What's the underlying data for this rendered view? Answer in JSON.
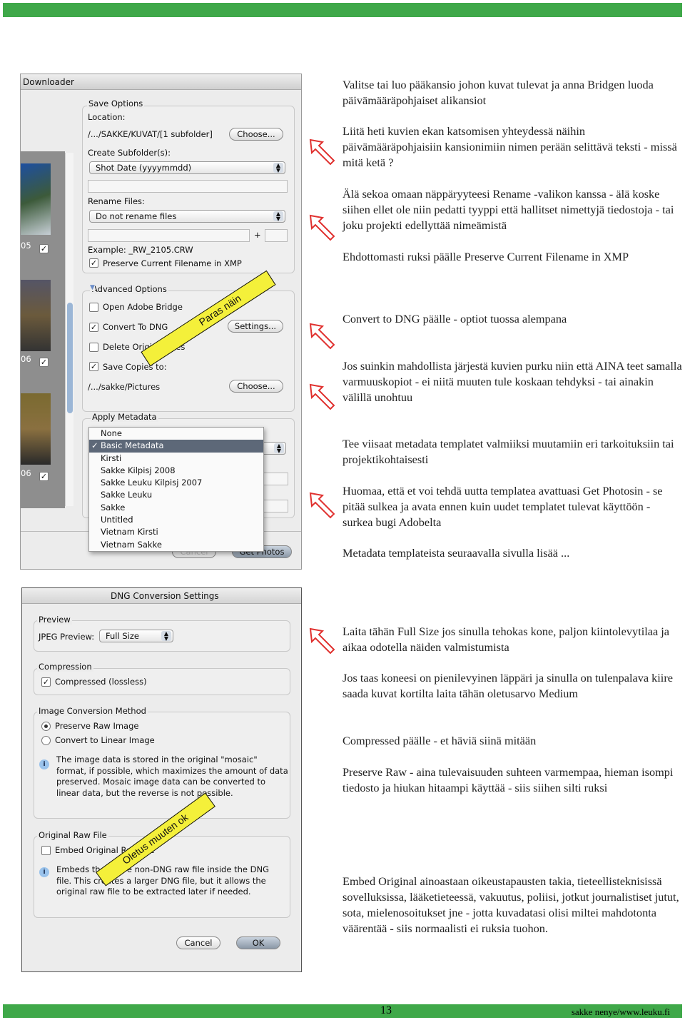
{
  "colors": {
    "green_bar": "#3fa849",
    "arrow": "#e0312f",
    "tape": "#f4f03a"
  },
  "downloader": {
    "title": "Downloader",
    "thumb_labels": [
      "05",
      "06",
      "06"
    ],
    "save_options": {
      "legend": "Save Options",
      "location_label": "Location:",
      "location_value": "/.../SAKKE/KUVAT/[1 subfolder]",
      "choose": "Choose...",
      "subfolder_label": "Create Subfolder(s):",
      "subfolder_value": "Shot Date (yyyymmdd)",
      "rename_label": "Rename Files:",
      "rename_value": "Do not rename files",
      "plus": "+",
      "example": "Example:  _RW_2105.CRW",
      "preserve": "Preserve Current Filename in XMP"
    },
    "advanced": {
      "legend": "Advanced Options",
      "open_bridge": "Open Adobe Bridge",
      "convert_dng": "Convert To DNG",
      "settings": "Settings...",
      "delete_originals": "Delete Original Files",
      "save_copies": "Save Copies to:",
      "copies_path": "/.../sakke/Pictures",
      "choose": "Choose..."
    },
    "metadata": {
      "legend": "Apply Metadata",
      "options": [
        "None",
        "Basic Metadata",
        "Kirsti",
        "Sakke Kilpisj 2008",
        "Sakke Leuku Kilpisj 2007",
        "Sakke Leuku",
        "Sakke",
        "Untitled",
        "Vietnam Kirsti",
        "Vietnam Sakke"
      ],
      "selected": "Basic Metadata"
    },
    "cancel": "Cancel",
    "get_photos": "Get Photos",
    "tape": "Paras näin"
  },
  "dng": {
    "title": "DNG Conversion Settings",
    "preview_legend": "Preview",
    "jpeg_label": "JPEG Preview:",
    "jpeg_value": "Full Size",
    "compression_legend": "Compression",
    "compressed": "Compressed (lossless)",
    "method_legend": "Image Conversion Method",
    "preserve_raw": "Preserve Raw Image",
    "linear": "Convert to Linear Image",
    "method_info": "The image data is stored in the original \"mosaic\" format, if possible, which maximizes the amount of data preserved. Mosaic image data can be converted to linear data, but the reverse is not possible.",
    "raw_legend": "Original Raw File",
    "embed": "Embed Original Raw File",
    "embed_info": "Embeds the entire non-DNG raw file inside the DNG file. This creates a larger DNG file, but it allows the original raw file to be extracted later if needed.",
    "cancel": "Cancel",
    "ok": "OK",
    "tape": "Oletus muuten ok"
  },
  "paragraphs": [
    "Valitse tai luo pääkansio johon kuvat tulevat ja anna Bridgen luoda päivämääräpohjaiset alikansiot",
    "Liitä heti kuvien ekan katsomisen yhteydessä näihin päivämääräpohjaisiin kansionimiin nimen perään selittävä teksti - missä mitä ketä ?",
    "Älä sekoa omaan näppäryyteesi Rename -valikon kanssa - älä koske siihen ellet ole niin pedatti tyyppi että hallitset nimettyjä tiedostoja - tai joku projekti edellyttää nimeämistä",
    "Ehdottomasti ruksi päälle Preserve Current Filename in XMP",
    "Convert to DNG päälle - optiot tuossa alempana",
    "Jos suinkin mahdollista järjestä kuvien purku niin että AINA teet samalla varmuuskopiot - ei niitä muuten tule koskaan tehdyksi - tai ainakin välillä unohtuu",
    "Tee viisaat metadata templatet valmiiksi muutamiin eri tarkoituksiin tai projektikohtaisesti",
    "Huomaa, että et voi tehdä uutta templatea avattuasi Get Photosin - se pitää sulkea ja avata ennen kuin uudet templatet tulevat käyttöön - surkea bugi Adobelta",
    "Metadata templateista seuraavalla sivulla lisää ...",
    "Laita tähän Full Size jos sinulla tehokas kone, paljon kiintolevytilaa ja aikaa odotella näiden valmistumista",
    "Jos taas koneesi on pienilevyinen läppäri ja sinulla on tulenpalava kiire saada kuvat kortilta laita tähän oletusarvo Medium",
    "Compressed päälle - et häviä siinä mitään",
    "Preserve Raw - aina tulevaisuuden suhteen varmempaa, hieman isompi tiedosto ja hiukan hitaampi käyttää - siis siihen silti ruksi",
    "Embed Original ainoastaan oikeustapausten takia, tieteellisteknisissä sovelluksissa, lääketieteessä, vakuutus, poliisi, jotkut journalistiset jutut, sota, mielenosoitukset jne - jotta kuvadatasi olisi miltei mahdotonta väärentää - siis normaalisti ei ruksia tuohon."
  ],
  "footer": {
    "page_number": "13",
    "credit": "sakke nenye/www.leuku.fi"
  }
}
